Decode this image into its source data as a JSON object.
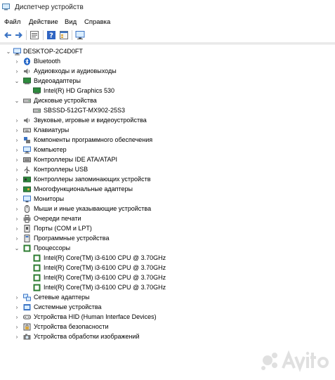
{
  "window": {
    "title": "Диспетчер устройств"
  },
  "menu": [
    "Файл",
    "Действие",
    "Вид",
    "Справка"
  ],
  "toolbar": [
    "back-icon",
    "forward-icon",
    "properties-icon",
    "help-icon",
    "view-icon",
    "monitor-icon"
  ],
  "tree": {
    "root": "DESKTOP-2C4D0FT",
    "categories": [
      {
        "label": "Bluetooth",
        "icon": "bluetooth-icon",
        "expanded": false
      },
      {
        "label": "Аудиовходы и аудиовыходы",
        "icon": "audio-icon",
        "expanded": false
      },
      {
        "label": "Видеоадаптеры",
        "icon": "display-adapter-icon",
        "expanded": true,
        "children": [
          "Intel(R) HD Graphics 530"
        ]
      },
      {
        "label": "Дисковые устройства",
        "icon": "disk-icon",
        "expanded": true,
        "children": [
          "SBSSD-512GT-MX902-25S3"
        ]
      },
      {
        "label": "Звуковые, игровые и видеоустройства",
        "icon": "sound-icon",
        "expanded": false
      },
      {
        "label": "Клавиатуры",
        "icon": "keyboard-icon",
        "expanded": false
      },
      {
        "label": "Компоненты программного обеспечения",
        "icon": "software-component-icon",
        "expanded": false
      },
      {
        "label": "Компьютер",
        "icon": "computer-icon",
        "expanded": false
      },
      {
        "label": "Контроллеры IDE ATA/ATAPI",
        "icon": "ide-controller-icon",
        "expanded": false
      },
      {
        "label": "Контроллеры USB",
        "icon": "usb-icon",
        "expanded": false
      },
      {
        "label": "Контроллеры запоминающих устройств",
        "icon": "storage-controller-icon",
        "expanded": false
      },
      {
        "label": "Многофункциональные адаптеры",
        "icon": "multifunction-icon",
        "expanded": false
      },
      {
        "label": "Мониторы",
        "icon": "monitor-icon",
        "expanded": false
      },
      {
        "label": "Мыши и иные указывающие устройства",
        "icon": "mouse-icon",
        "expanded": false
      },
      {
        "label": "Очереди печати",
        "icon": "printer-icon",
        "expanded": false
      },
      {
        "label": "Порты (COM и LPT)",
        "icon": "port-icon",
        "expanded": false
      },
      {
        "label": "Программные устройства",
        "icon": "software-device-icon",
        "expanded": false
      },
      {
        "label": "Процессоры",
        "icon": "processor-icon",
        "expanded": true,
        "children": [
          "Intel(R) Core(TM) i3-6100 CPU @ 3.70GHz",
          "Intel(R) Core(TM) i3-6100 CPU @ 3.70GHz",
          "Intel(R) Core(TM) i3-6100 CPU @ 3.70GHz",
          "Intel(R) Core(TM) i3-6100 CPU @ 3.70GHz"
        ]
      },
      {
        "label": "Сетевые адаптеры",
        "icon": "network-icon",
        "expanded": false
      },
      {
        "label": "Системные устройства",
        "icon": "system-device-icon",
        "expanded": false
      },
      {
        "label": "Устройства HID (Human Interface Devices)",
        "icon": "hid-icon",
        "expanded": false
      },
      {
        "label": "Устройства безопасности",
        "icon": "security-device-icon",
        "expanded": false
      },
      {
        "label": "Устройства обработки изображений",
        "icon": "imaging-device-icon",
        "expanded": false
      }
    ]
  }
}
